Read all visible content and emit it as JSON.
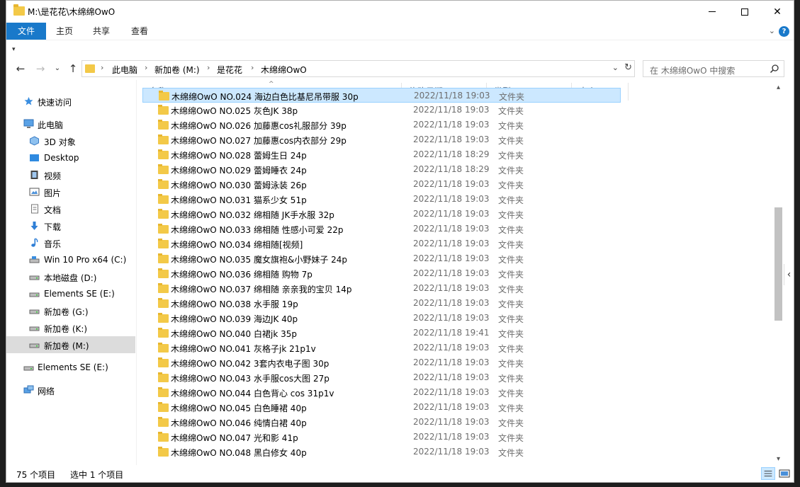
{
  "window": {
    "title": "M:\\是花花\\木绵绵OwO"
  },
  "ribbon": {
    "tabs": [
      "文件",
      "主页",
      "共享",
      "查看"
    ],
    "help": "?"
  },
  "address": {
    "crumbs": [
      "此电脑",
      "新加卷 (M:)",
      "是花花",
      "木绵绵OwO"
    ]
  },
  "search": {
    "placeholder": "在 木绵绵OwO 中搜索"
  },
  "sidebar": {
    "items": [
      {
        "label": "快速访问",
        "icon": "star-icon"
      },
      {
        "label": "此电脑",
        "icon": "computer-icon"
      },
      {
        "label": "3D 对象",
        "icon": "3d-objects-icon"
      },
      {
        "label": "Desktop",
        "icon": "desktop-icon"
      },
      {
        "label": "视频",
        "icon": "video-icon"
      },
      {
        "label": "图片",
        "icon": "pictures-icon"
      },
      {
        "label": "文档",
        "icon": "documents-icon"
      },
      {
        "label": "下载",
        "icon": "download-icon"
      },
      {
        "label": "音乐",
        "icon": "music-icon"
      },
      {
        "label": "Win 10 Pro x64 (C:)",
        "icon": "drive-icon"
      },
      {
        "label": "本地磁盘 (D:)",
        "icon": "drive-icon"
      },
      {
        "label": "Elements SE (E:)",
        "icon": "drive-icon"
      },
      {
        "label": "新加卷 (G:)",
        "icon": "drive-icon"
      },
      {
        "label": "新加卷 (K:)",
        "icon": "drive-icon"
      },
      {
        "label": "新加卷 (M:)",
        "icon": "drive-icon",
        "selected": true
      },
      {
        "label": "Elements SE (E:)",
        "icon": "drive-icon"
      },
      {
        "label": "网络",
        "icon": "network-icon"
      }
    ]
  },
  "columns": {
    "name": "名称",
    "date": "修改日期",
    "type": "类型",
    "size": "大小"
  },
  "files": [
    {
      "name": "木绵绵OwO NO.024 海边白色比基尼吊带服 30p",
      "date": "2022/11/18 19:03",
      "type": "文件夹"
    },
    {
      "name": "木绵绵OwO NO.025 灰色JK 38p",
      "date": "2022/11/18 19:03",
      "type": "文件夹"
    },
    {
      "name": "木绵绵OwO NO.026 加藤惠cos礼服部分 39p",
      "date": "2022/11/18 19:03",
      "type": "文件夹"
    },
    {
      "name": "木绵绵OwO NO.027 加藤惠cos内衣部分 29p",
      "date": "2022/11/18 19:03",
      "type": "文件夹"
    },
    {
      "name": "木绵绵OwO NO.028 蕾姆生日 24p",
      "date": "2022/11/18 18:29",
      "type": "文件夹"
    },
    {
      "name": "木绵绵OwO NO.029 蕾姆睡衣 24p",
      "date": "2022/11/18 18:29",
      "type": "文件夹"
    },
    {
      "name": "木绵绵OwO NO.030 蕾姆泳装 26p",
      "date": "2022/11/18 19:03",
      "type": "文件夹"
    },
    {
      "name": "木绵绵OwO NO.031 猫系少女 51p",
      "date": "2022/11/18 19:03",
      "type": "文件夹"
    },
    {
      "name": "木绵绵OwO NO.032 绵相随 JK手水服 32p",
      "date": "2022/11/18 19:03",
      "type": "文件夹"
    },
    {
      "name": "木绵绵OwO NO.033 绵相随 性感小可爱 22p",
      "date": "2022/11/18 19:03",
      "type": "文件夹"
    },
    {
      "name": "木绵绵OwO NO.034 绵相随[视频]",
      "date": "2022/11/18 19:03",
      "type": "文件夹"
    },
    {
      "name": "木绵绵OwO NO.035 魔女旗袍&小野妹子 24p",
      "date": "2022/11/18 19:03",
      "type": "文件夹"
    },
    {
      "name": "木绵绵OwO NO.036 绵相随 购物 7p",
      "date": "2022/11/18 19:03",
      "type": "文件夹"
    },
    {
      "name": "木绵绵OwO NO.037 绵相随 亲亲我的宝贝 14p",
      "date": "2022/11/18 19:03",
      "type": "文件夹"
    },
    {
      "name": "木绵绵OwO NO.038 水手服 19p",
      "date": "2022/11/18 19:03",
      "type": "文件夹"
    },
    {
      "name": "木绵绵OwO NO.039 海边JK 40p",
      "date": "2022/11/18 19:03",
      "type": "文件夹"
    },
    {
      "name": "木绵绵OwO NO.040 白裙jk 35p",
      "date": "2022/11/18 19:41",
      "type": "文件夹"
    },
    {
      "name": "木绵绵OwO NO.041 灰格子jk 21p1v",
      "date": "2022/11/18 19:03",
      "type": "文件夹"
    },
    {
      "name": "木绵绵OwO NO.042 3套内衣电子图 30p",
      "date": "2022/11/18 19:03",
      "type": "文件夹"
    },
    {
      "name": "木绵绵OwO NO.043 水手服cos大图 27p",
      "date": "2022/11/18 19:03",
      "type": "文件夹"
    },
    {
      "name": "木绵绵OwO NO.044 白色背心 cos 31p1v",
      "date": "2022/11/18 19:03",
      "type": "文件夹"
    },
    {
      "name": "木绵绵OwO NO.045 白色睡裙 40p",
      "date": "2022/11/18 19:03",
      "type": "文件夹"
    },
    {
      "name": "木绵绵OwO NO.046 纯情白裙 40p",
      "date": "2022/11/18 19:03",
      "type": "文件夹"
    },
    {
      "name": "木绵绵OwO NO.047 光和影 41p",
      "date": "2022/11/18 19:03",
      "type": "文件夹"
    },
    {
      "name": "木绵绵OwO NO.048 黑白修女 40p",
      "date": "2022/11/18 19:03",
      "type": "文件夹"
    }
  ],
  "status": {
    "count": "75 个项目",
    "selected": "选中 1 个项目"
  },
  "colors": {
    "accent": "#1979ca",
    "folder": "#f3c948",
    "selection": "#cce8ff",
    "header_text": "#4c607a",
    "meta_text": "#6d6d6d"
  }
}
